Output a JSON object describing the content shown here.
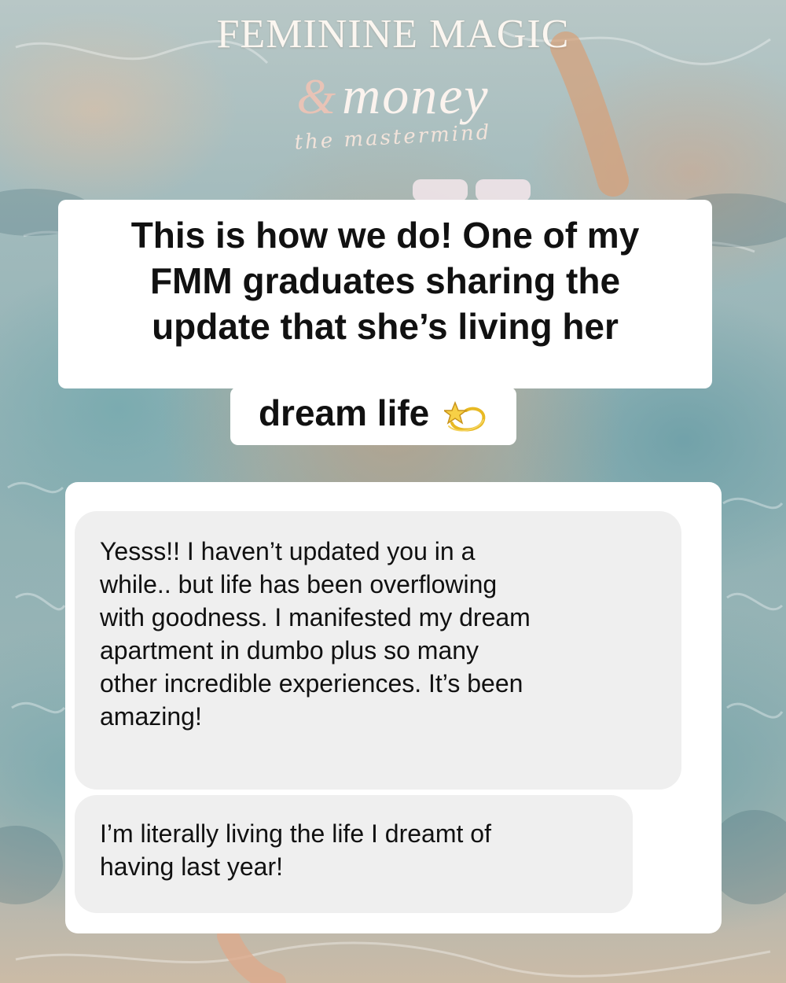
{
  "brand": {
    "line1": "FEMININE MAGIC",
    "ampersand": "&",
    "money": "money",
    "script": "the mastermind"
  },
  "caption": {
    "lines": [
      "This is how we do! One of my",
      "FMM graduates sharing the",
      "update that she’s living her",
      "dream life"
    ],
    "emoji_icon": "dizzy-star-icon"
  },
  "messages": [
    {
      "lines": [
        "Yesss!! I haven’t updated you in a",
        "while.. but life has been overflowing",
        "with goodness. I manifested my dream",
        "apartment in dumbo plus so many",
        "other incredible experiences. It’s been",
        "amazing!"
      ]
    },
    {
      "lines": [
        "I’m literally living the life I dreamt of",
        "having last year!"
      ]
    }
  ],
  "colors": {
    "caption_bg": "#ffffff",
    "bubble_bg": "#efefef",
    "text": "#111111",
    "brand_text": "#fbf6f0",
    "brand_amp": "#e8c3b6"
  }
}
